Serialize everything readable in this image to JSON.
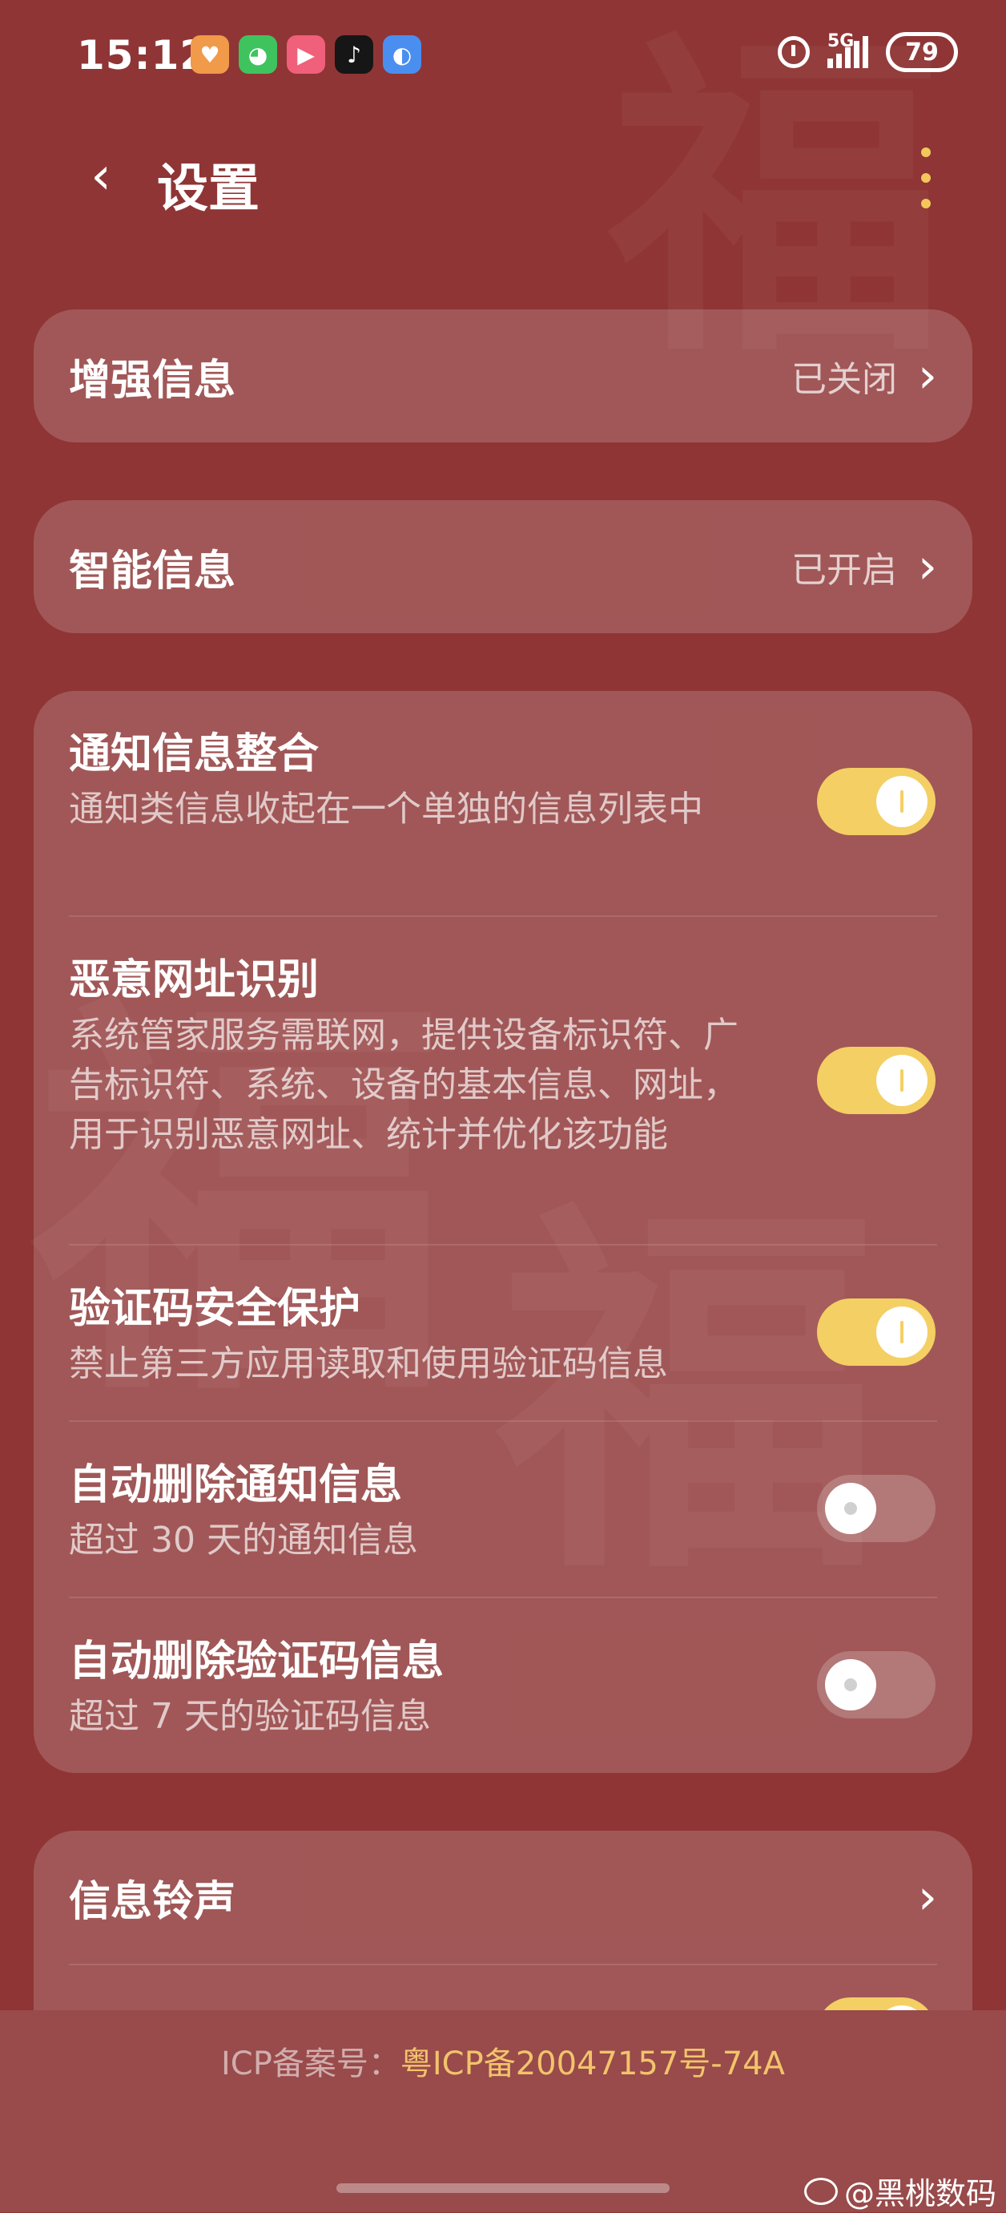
{
  "status_bar": {
    "time": "15:12",
    "network": "5G",
    "battery": "79",
    "app_icons": [
      {
        "name": "heart-app-icon",
        "glyph": "♥",
        "color": "#f09a4a"
      },
      {
        "name": "wechat-icon",
        "glyph": "◕",
        "color": "#3fc35e"
      },
      {
        "name": "video-app-icon",
        "glyph": "▶",
        "color": "#f0607a"
      },
      {
        "name": "tiktok-icon",
        "glyph": "♪",
        "color": "#161616"
      },
      {
        "name": "browser-icon",
        "glyph": "◐",
        "color": "#4a8ff0"
      }
    ]
  },
  "header": {
    "back_icon": "‹",
    "title": "设置"
  },
  "rows": {
    "enhanced": {
      "label": "增强信息",
      "value": "已关闭"
    },
    "smart": {
      "label": "智能信息",
      "value": "已开启"
    },
    "notif_merge": {
      "title": "通知信息整合",
      "desc": "通知类信息收起在一个单独的信息列表中",
      "on": true
    },
    "malicious_url": {
      "title": "恶意网址识别",
      "desc": "系统管家服务需联网，提供设备标识符、广告标识符、系统、设备的基本信息、网址，用于识别恶意网址、统计并优化该功能",
      "on": true
    },
    "code_protect": {
      "title": "验证码安全保护",
      "desc": "禁止第三方应用读取和使用验证码信息",
      "on": true
    },
    "auto_del_notif": {
      "title": "自动删除通知信息",
      "desc": "超过 30 天的通知信息",
      "on": false
    },
    "auto_del_code": {
      "title": "自动删除验证码信息",
      "desc": "超过 7 天的验证码信息",
      "on": false
    },
    "ringtone": {
      "label": "信息铃声"
    }
  },
  "chevron": "›",
  "footer": {
    "icp_key": "ICP备案号：",
    "icp_value": "粤ICP备20047157号-74A",
    "watermark": "@黑桃数码"
  },
  "colors": {
    "background": "#8f3535",
    "accent": "#f4cf63",
    "card": "rgba(255,255,255,0.17)"
  }
}
